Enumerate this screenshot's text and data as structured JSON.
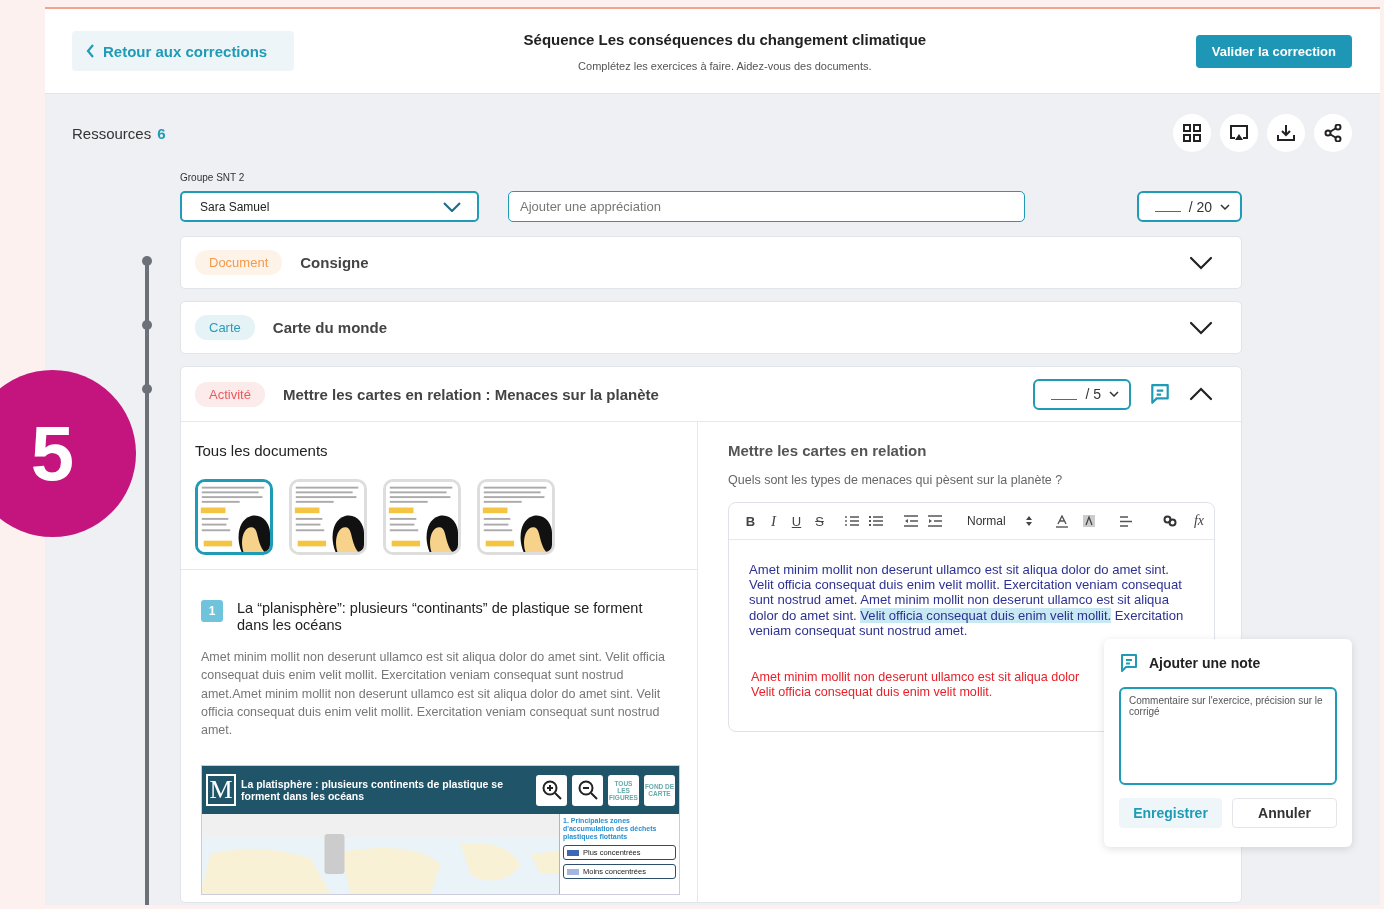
{
  "step_badge": "5",
  "header": {
    "back": "Retour aux corrections",
    "title": "Séquence Les conséquences du changement climatique",
    "subtitle": "Complétez les exercices à faire. Aidez-vous des documents.",
    "validate": "Valider la correction"
  },
  "resources": {
    "label": "Ressources",
    "count": "6"
  },
  "student": {
    "group_label": "Groupe SNT 2",
    "name": "Sara Samuel",
    "appreciation_placeholder": "Ajouter une appréciation",
    "grade_max": "/ 20"
  },
  "sections": [
    {
      "kind": "document",
      "tag": "Document",
      "color": "#f39a4c",
      "title": "Consigne",
      "expanded": false
    },
    {
      "kind": "map",
      "tag": "Carte",
      "color": "#2a9bb8",
      "title": "Carte du monde",
      "expanded": false
    },
    {
      "kind": "activity",
      "tag": "Activité",
      "color": "#ea5a5e",
      "title": "Mettre les cartes en relation : Menaces sur la planète",
      "expanded": true,
      "grade_max": "/ 5"
    }
  ],
  "activity": {
    "documents": {
      "title": "Tous les documents",
      "thumbnails": [
        {
          "kind": "picture",
          "selected": true
        },
        {
          "kind": "picture",
          "selected": false
        },
        {
          "kind": "picture",
          "selected": false
        },
        {
          "kind": "picture",
          "selected": false
        }
      ]
    },
    "document": {
      "number": "1",
      "heading": "La “planisphère”: plusieurs “continants” de plastique se forment dans les océans",
      "body": "Amet minim mollit non deserunt ullamco est sit aliqua dolor do amet sint. Velit officia consequat duis enim velit mollit. Exercitation veniam consequat sunt nostrud amet.Amet minim mollit non deserunt ullamco est sit aliqua dolor do amet sint. Velit officia consequat duis enim velit mollit. Exercitation veniam consequat sunt nostrud amet."
    },
    "map_embed": {
      "logo": "M",
      "title": "La platisphère : plusieurs continents de plastique se forment dans les océans",
      "buttons": [
        "TOUS LES FIGURES",
        "FOND DE CARTE"
      ],
      "legend_title": "1. Principales zones d'accumulation des déchets plastiques flottants",
      "legend": [
        {
          "label": "Plus concentrées",
          "color": "#3d66b3"
        },
        {
          "label": "Moins concentrées",
          "color": "#a3b6e2"
        }
      ]
    },
    "exercise": {
      "title": "Mettre les cartes en relation",
      "question": "Quels sont les types de menaces qui pèsent sur la planète ?",
      "format_buttons": [
        "B",
        "I",
        "U",
        "S"
      ],
      "style": "Normal",
      "formula": "fx",
      "answer": [
        {
          "text": "Amet minim mollit non deserunt ullamco est sit aliqua dolor do amet sint. Velit officia consequat duis enim velit mollit. Exercitation veniam consequat sunt nostrud amet. Amet minim mollit non deserunt ullamco est sit aliqua dolor do amet sint. ",
          "highlighted": false
        },
        {
          "text": "Velit officia consequat duis enim velit mollit.",
          "highlighted": true
        },
        {
          "text": " Exercitation veniam consequat sunt nostrud amet.",
          "highlighted": false
        }
      ],
      "correction_lines": [
        "Amet minim mollit non deserunt ullamco est sit aliqua dolor",
        "Velit officia consequat duis enim velit mollit."
      ]
    }
  },
  "note_popover": {
    "title": "Ajouter une note",
    "placeholder": "Commentaire sur l'exercice, précision sur le corrigé",
    "save": "Enregistrer",
    "cancel": "Annuler"
  }
}
